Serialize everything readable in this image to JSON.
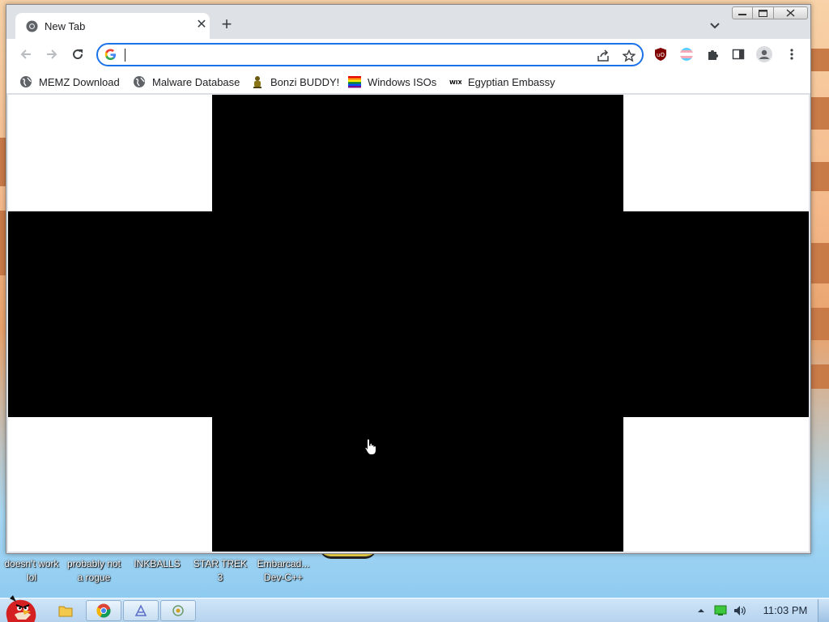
{
  "browser": {
    "tab": {
      "title": "New Tab"
    },
    "omnibox": {
      "value": "",
      "placeholder": ""
    },
    "bookmarks": [
      {
        "label": "MEMZ Download",
        "icon": "globe-icon"
      },
      {
        "label": "Malware Database",
        "icon": "globe-icon"
      },
      {
        "label": "Bonzi BUDDY!",
        "icon": "bonzi-icon"
      },
      {
        "label": "Windows ISOs",
        "icon": "rainbow-flag-icon"
      },
      {
        "label": "Egyptian Embassy",
        "icon": "wix-icon"
      }
    ],
    "wix_logo_text": "WIX"
  },
  "desktop": {
    "icons": [
      {
        "label": "doesn't work lol"
      },
      {
        "label": "probably not a rogue"
      },
      {
        "label": "INKBALLS"
      },
      {
        "label": "STAR TREK 3"
      },
      {
        "label": "Embarcad... Dev-C++"
      }
    ]
  },
  "taskbar": {
    "clock": "11:03 PM",
    "pinned": [
      "folder-icon",
      "chrome-icon",
      "app-icon",
      "app-icon"
    ]
  },
  "colors": {
    "accent": "#1a73e8",
    "content_fill": "#000000",
    "taskbar": "#c3dcf3"
  }
}
